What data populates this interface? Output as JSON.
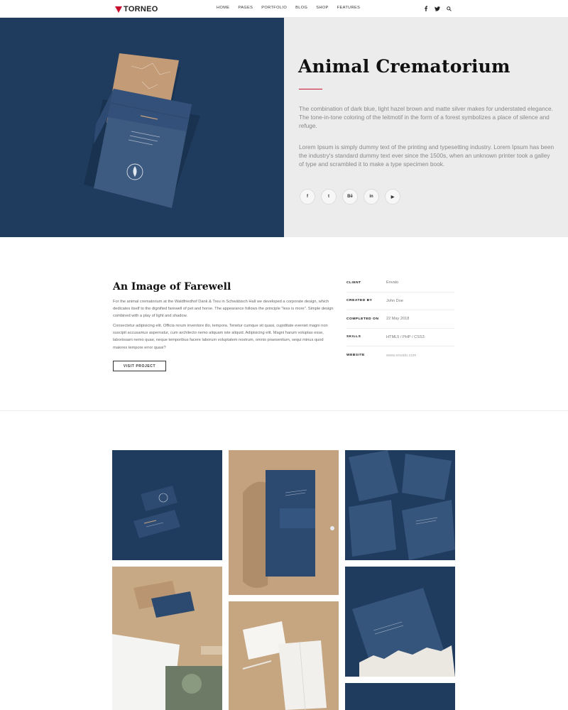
{
  "header": {
    "logo": "TORNEO",
    "nav": [
      "HOME",
      "PAGES",
      "PORTFOLIO",
      "BLOG",
      "SHOP",
      "FEATURES"
    ],
    "icons": [
      "facebook-icon",
      "twitter-icon",
      "search-icon"
    ]
  },
  "hero": {
    "title": "Animal Crematorium",
    "p1": "The combination of dark blue, light hazel brown and matte silver makes for understated elegance. The tone-in-tone coloring of the leitmotif in the form of a forest symbolizes a place of silence and refuge.",
    "p2": "Lorem Ipsum is simply dummy text of the printing and typesetting industry. Lorem Ipsum has been the industry's standard dummy text ever since the 1500s, when an unknown printer took a galley of type and scrambled it to make a type specimen book.",
    "social": [
      {
        "name": "facebook-icon",
        "glyph": "f"
      },
      {
        "name": "twitter-icon",
        "glyph": "t"
      },
      {
        "name": "behance-icon",
        "glyph": "Bē"
      },
      {
        "name": "linkedin-icon",
        "glyph": "in"
      },
      {
        "name": "youtube-icon",
        "glyph": "▶"
      }
    ]
  },
  "info": {
    "title": "An Image of Farewell",
    "p1": "For the animal crematorium at the Waldfriedhof Dank & Treu in Schwäbisch Hall we developed a corporate design, which dedicates itself to the dignified farewell of pet and horse. The appearance follows the principle \"less is more\". Simple design combined with a play of light and shadow.",
    "p2": "Consectetur adipisicing elit. Officia rerum inventore illo, tempora. Tenetur cumque sit quasi, cupiditate eveniet magni non suscipit accusamus aspernatur, cum architecto nemo aliquam iste aliquid. Adipisicing elit. Magni harum voluptas esse, laboriosam nemo quae, neque temporibus facere laborum voluptatem nostrum, omnis praesentium, sequi minus quod maiores tempore error quasi?",
    "button": "VISIT PROJECT"
  },
  "details": [
    {
      "label": "CLIENT",
      "value": "Envato"
    },
    {
      "label": "CREATED BY",
      "value": "John Doe"
    },
    {
      "label": "COMPLETED ON",
      "value": "22 May 2018"
    },
    {
      "label": "SKILLS",
      "value": "HTML5 / PHP / CSS3"
    },
    {
      "label": "WEBSITE",
      "value": "www.envato.com"
    }
  ],
  "colors": {
    "accent": "#c8102e",
    "navy": "#1e3a5c",
    "kraft": "#b89a76",
    "light_gray": "#ececec"
  }
}
